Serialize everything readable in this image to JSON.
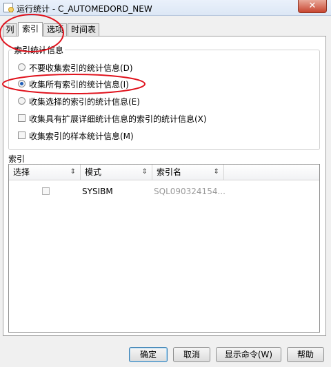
{
  "window": {
    "title": "运行统计 - C_AUTOMEDORD_NEW",
    "close_symbol": "✕"
  },
  "tabs": [
    {
      "label": "列",
      "active": false
    },
    {
      "label": "索引",
      "active": true
    },
    {
      "label": "选项",
      "active": false
    },
    {
      "label": "时间表",
      "active": false
    }
  ],
  "stats_group": {
    "title": "索引统计信息",
    "options": [
      {
        "label": "不要收集索引的统计信息(D)",
        "type": "radio",
        "selected": false
      },
      {
        "label": "收集所有索引的统计信息(I)",
        "type": "radio",
        "selected": true
      },
      {
        "label": "收集选择的索引的统计信息(E)",
        "type": "radio",
        "selected": false
      },
      {
        "label": "收集具有扩展详细统计信息的索引的统计信息(X)",
        "type": "checkbox",
        "checked": false
      },
      {
        "label": "收集索引的样本统计信息(M)",
        "type": "checkbox",
        "checked": false
      }
    ]
  },
  "index_section": {
    "label": "索引",
    "columns": [
      "选择",
      "模式",
      "索引名"
    ],
    "sort_symbol": "⇕",
    "rows": [
      {
        "selected": false,
        "schema": "SYSIBM",
        "index_name": "SQL090324154..."
      }
    ]
  },
  "buttons": {
    "ok": "确定",
    "cancel": "取消",
    "show_command": "显示命令(W)",
    "help": "帮助"
  },
  "annotation_color": "#e0141e"
}
